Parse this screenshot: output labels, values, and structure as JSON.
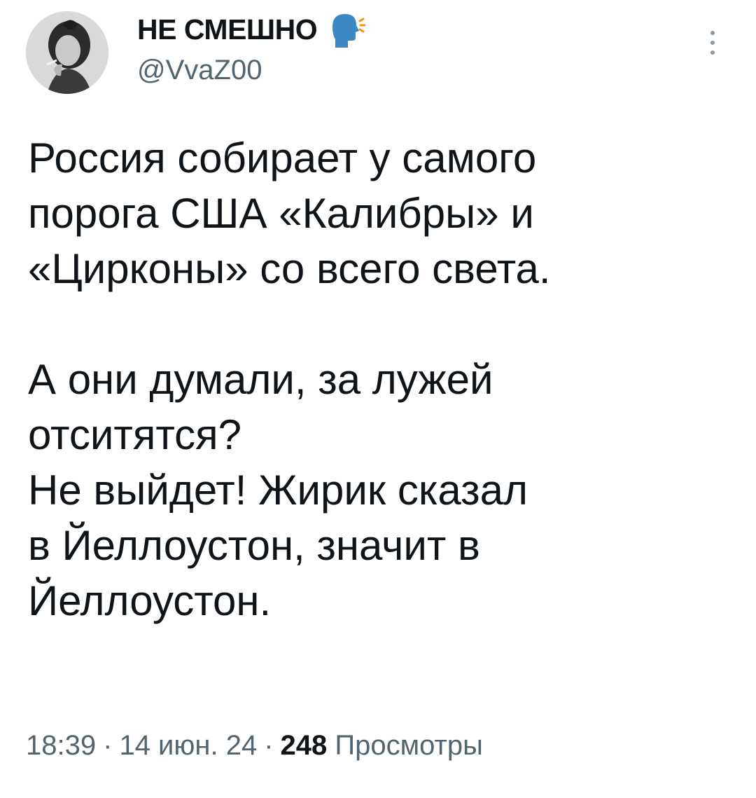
{
  "author": {
    "display_name": "НЕ СМЕШНО",
    "badge_icon": "speaking-head-icon",
    "handle": "@VvaZ00",
    "avatar_icon": "avatar-photo"
  },
  "tweet": {
    "lines": [
      "Россия собирает у самого",
      "порога США «Калибры» и",
      "«Цирконы» со всего света.",
      "",
      "А они думали, за лужей",
      "отситятся?",
      "Не выйдет! Жирик сказал",
      "в Йеллоустон, значит в",
      "Йеллоустон."
    ]
  },
  "meta": {
    "time": "18:39",
    "separator": "·",
    "date": "14 июн. 24",
    "views_count": "248",
    "views_label": "Просмотры"
  },
  "colors": {
    "text": "#0f1419",
    "secondary": "#536471",
    "badge_head": "#3b88c3"
  },
  "menu_icon": "more-vertical-icon"
}
